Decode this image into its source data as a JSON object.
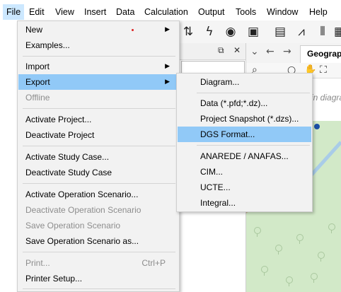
{
  "menubar": {
    "items": [
      "File",
      "Edit",
      "View",
      "Insert",
      "Data",
      "Calculation",
      "Output",
      "Tools",
      "Window",
      "Help"
    ]
  },
  "file_menu": {
    "items": [
      {
        "label": "New",
        "submenu": true
      },
      {
        "label": "Examples..."
      },
      {
        "label": "Import",
        "submenu": true
      },
      {
        "label": "Export",
        "submenu": true,
        "highlighted": true
      },
      {
        "label": "Offline",
        "submenu": true,
        "disabled": true
      },
      {
        "label": "Activate Project..."
      },
      {
        "label": "Deactivate Project"
      },
      {
        "label": "Activate Study Case..."
      },
      {
        "label": "Deactivate Study Case"
      },
      {
        "label": "Activate Operation Scenario..."
      },
      {
        "label": "Deactivate Operation Scenario",
        "disabled": true
      },
      {
        "label": "Save Operation Scenario",
        "disabled": true
      },
      {
        "label": "Save Operation Scenario as..."
      },
      {
        "label": "Print...",
        "shortcut": "Ctrl+P",
        "disabled": true
      },
      {
        "label": "Printer Setup..."
      }
    ],
    "arrow_glyph": "▶"
  },
  "export_submenu": {
    "items": [
      {
        "label": "Diagram..."
      },
      {
        "label": "Data (*.pfd;*.dz)..."
      },
      {
        "label": "Project Snapshot (*.dzs)..."
      },
      {
        "label": "DGS Format...",
        "highlighted": true
      },
      {
        "label": "ANAREDE / ANAFAS..."
      },
      {
        "label": "CIM..."
      },
      {
        "label": "UCTE..."
      },
      {
        "label": "Integral..."
      }
    ]
  },
  "background": {
    "panel_controls": [
      "⧉",
      "✕"
    ],
    "geo_tab_label": "Geograp",
    "map_hint": "in diagra",
    "nav_glyphs": [
      "⌄",
      "←",
      "→"
    ]
  },
  "colors": {
    "menu_bg": "#f2f2f2",
    "highlight": "#91c9f7",
    "disabled_text": "#8d8d8d",
    "map_green": "#d2e9c8"
  }
}
